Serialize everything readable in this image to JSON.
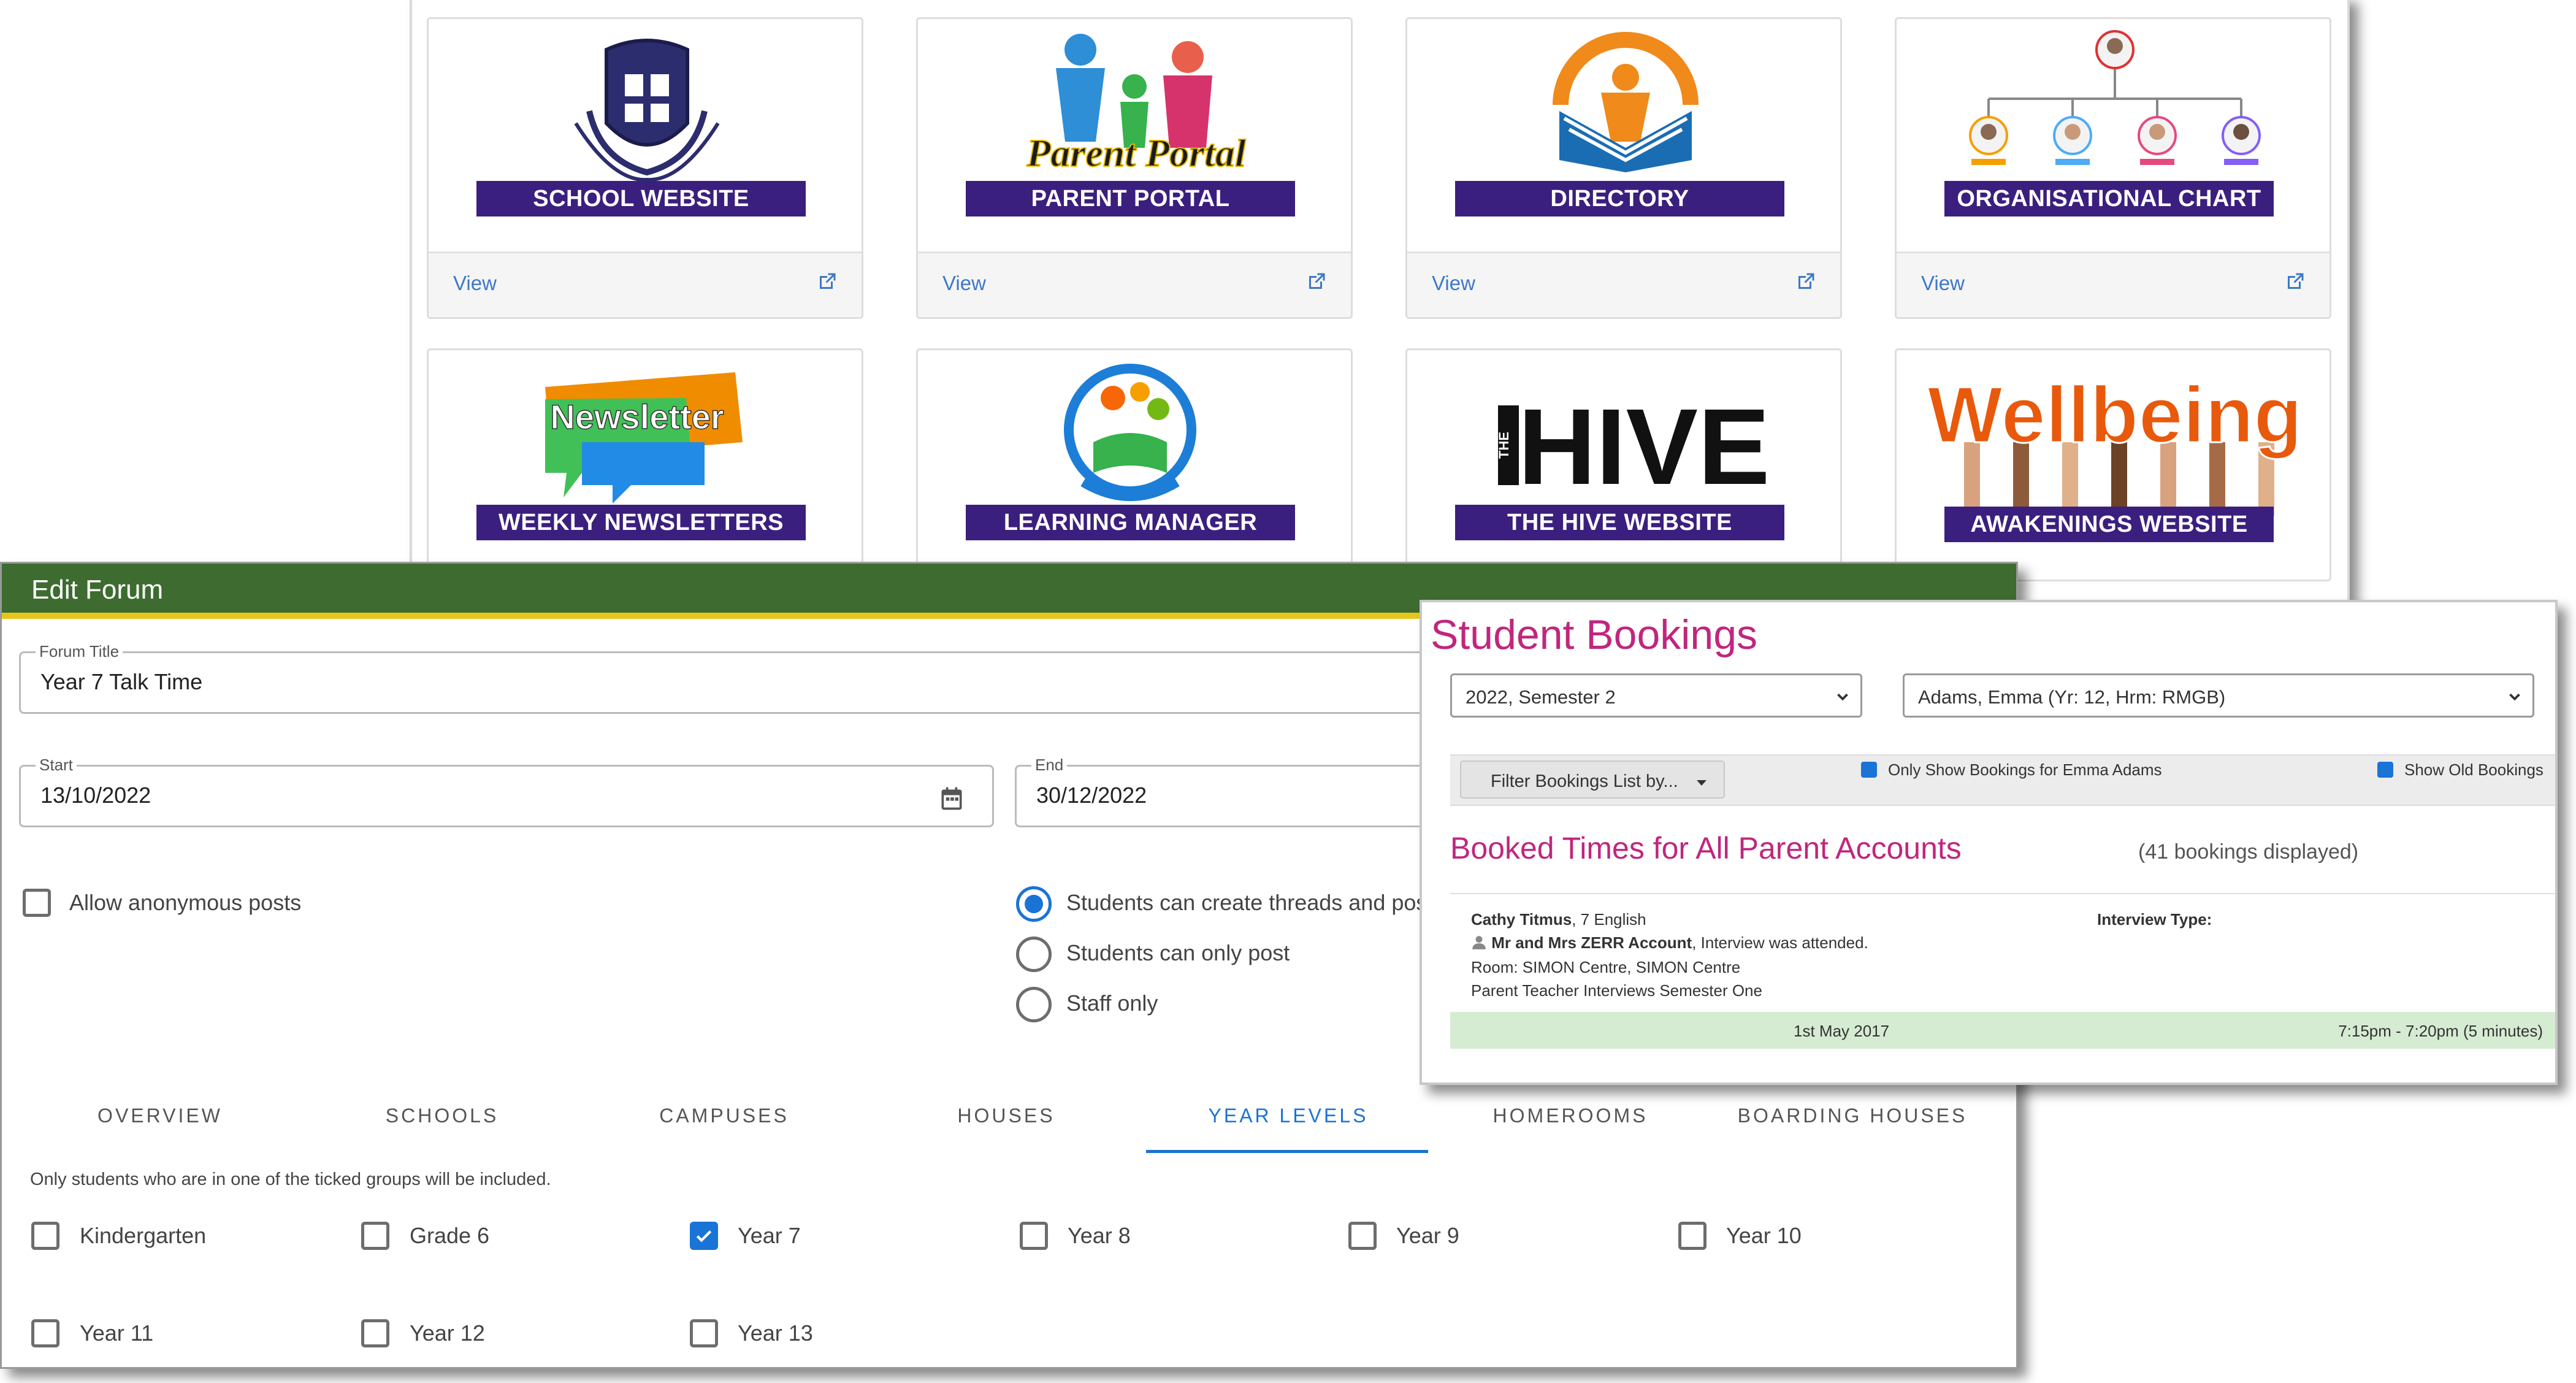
{
  "tiles": [
    {
      "title": "SCHOOL WEBSITE",
      "view": "View"
    },
    {
      "title": "PARENT PORTAL",
      "view": "View",
      "logo_text": "Parent Portal"
    },
    {
      "title": "DIRECTORY",
      "view": "View"
    },
    {
      "title": "ORGANISATIONAL CHART",
      "view": "View"
    },
    {
      "title": "WEEKLY NEWSLETTERS",
      "logo_text": "Newsletter"
    },
    {
      "title": "LEARNING MANAGER"
    },
    {
      "title": "THE HIVE WEBSITE",
      "logo_text": "HIVE",
      "logo_small": "THE"
    },
    {
      "title": "AWAKENINGS WEBSITE",
      "logo_text": "Wellbeing"
    }
  ],
  "colors": {
    "banner": "#3b1f7e",
    "forum_header": "#3d6b30",
    "forum_stripe": "#e6c619",
    "accent": "#1a73d6",
    "bookings_title": "#c0267e"
  },
  "forum": {
    "header": "Edit Forum",
    "title_label": "Forum Title",
    "title_value": "Year 7 Talk Time",
    "start_label": "Start",
    "start_value": "13/10/2022",
    "end_label": "End",
    "end_value": "30/12/2022",
    "anonymous_label": "Allow anonymous posts",
    "anonymous_checked": false,
    "options": [
      {
        "label": "Students can create threads and pos",
        "selected": true
      },
      {
        "label": "Students can only post",
        "selected": false
      },
      {
        "label": "Staff only",
        "selected": false
      }
    ],
    "tabs": [
      "OVERVIEW",
      "SCHOOLS",
      "CAMPUSES",
      "HOUSES",
      "YEAR LEVELS",
      "HOMEROOMS",
      "BOARDING HOUSES"
    ],
    "active_tab": "YEAR LEVELS",
    "note": "Only students who are in one of the ticked groups will be included.",
    "year_levels": [
      {
        "label": "Kindergarten",
        "checked": false
      },
      {
        "label": "Grade 6",
        "checked": false
      },
      {
        "label": "Year 7",
        "checked": true
      },
      {
        "label": "Year 8",
        "checked": false
      },
      {
        "label": "Year 9",
        "checked": false
      },
      {
        "label": "Year 10",
        "checked": false
      },
      {
        "label": "Year 11",
        "checked": false
      },
      {
        "label": "Year 12",
        "checked": false
      },
      {
        "label": "Year 13",
        "checked": false
      }
    ]
  },
  "bookings": {
    "title": "Student Bookings",
    "semester_select": "2022, Semester 2",
    "student_select": "Adams, Emma (Yr: 12, Hrm: RMGB)",
    "filter_button": "Filter Bookings List by...",
    "only_show_label": "Only Show Bookings for Emma Adams",
    "show_old_label": "Show Old Bookings",
    "section_title": "Booked Times for All Parent Accounts",
    "count_text": "(41 bookings displayed)",
    "entry": {
      "teacher": "Cathy Titmus",
      "subject": ", 7 English",
      "parent": "Mr and Mrs ZERR Account",
      "status": ", Interview was attended.",
      "room": "Room: SIMON Centre, SIMON Centre",
      "event": "Parent Teacher Interviews Semester One",
      "interview_type_label": "Interview Type:",
      "date": "1st May 2017",
      "time": "7:15pm - 7:20pm (5 minutes)"
    }
  }
}
